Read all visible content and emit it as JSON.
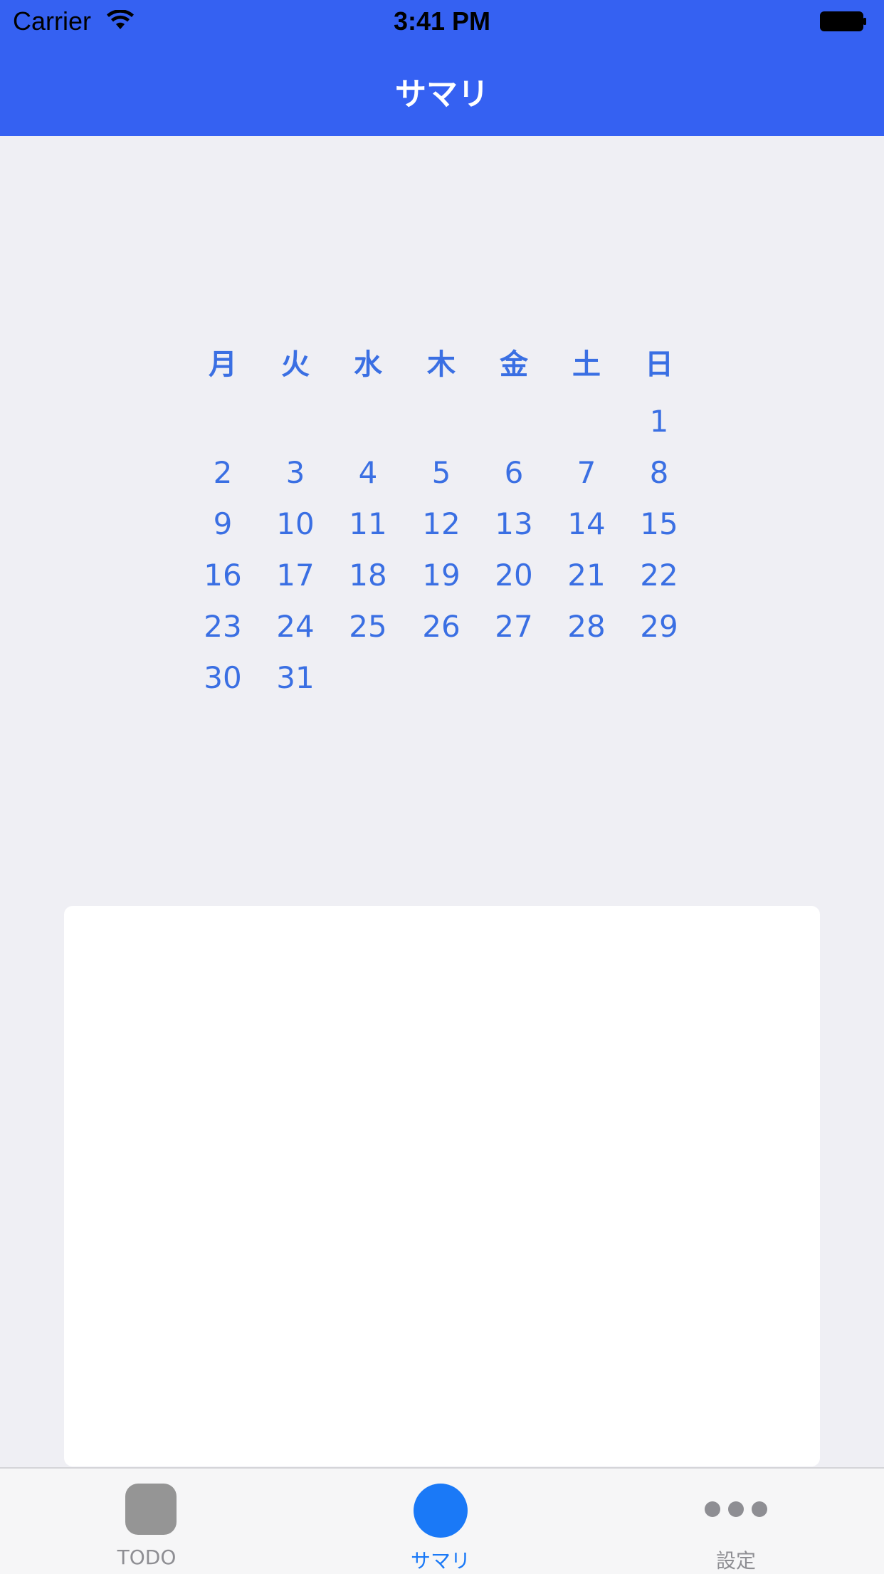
{
  "status_bar": {
    "carrier": "Carrier",
    "time": "3:41 PM"
  },
  "nav": {
    "title": "サマリ"
  },
  "calendar": {
    "weekdays": [
      "月",
      "火",
      "水",
      "木",
      "金",
      "土",
      "日"
    ],
    "first_weekday_index": 6,
    "days": [
      "1",
      "2",
      "3",
      "4",
      "5",
      "6",
      "7",
      "8",
      "9",
      "10",
      "11",
      "12",
      "13",
      "14",
      "15",
      "16",
      "17",
      "18",
      "19",
      "20",
      "21",
      "22",
      "23",
      "24",
      "25",
      "26",
      "27",
      "28",
      "29",
      "30",
      "31"
    ],
    "color": "#3a6fe3"
  },
  "tabbar": {
    "tabs": [
      {
        "label": "TODO",
        "icon": "rounded-square-icon",
        "selected": false
      },
      {
        "label": "サマリ",
        "icon": "circle-icon",
        "selected": true
      },
      {
        "label": "設定",
        "icon": "more-dots-icon",
        "selected": false
      }
    ],
    "selected_color": "#1a79f7",
    "unselected_color": "#8e8e93"
  },
  "colors": {
    "header": "#3561f2",
    "background": "#efeff4",
    "card": "#ffffff"
  }
}
